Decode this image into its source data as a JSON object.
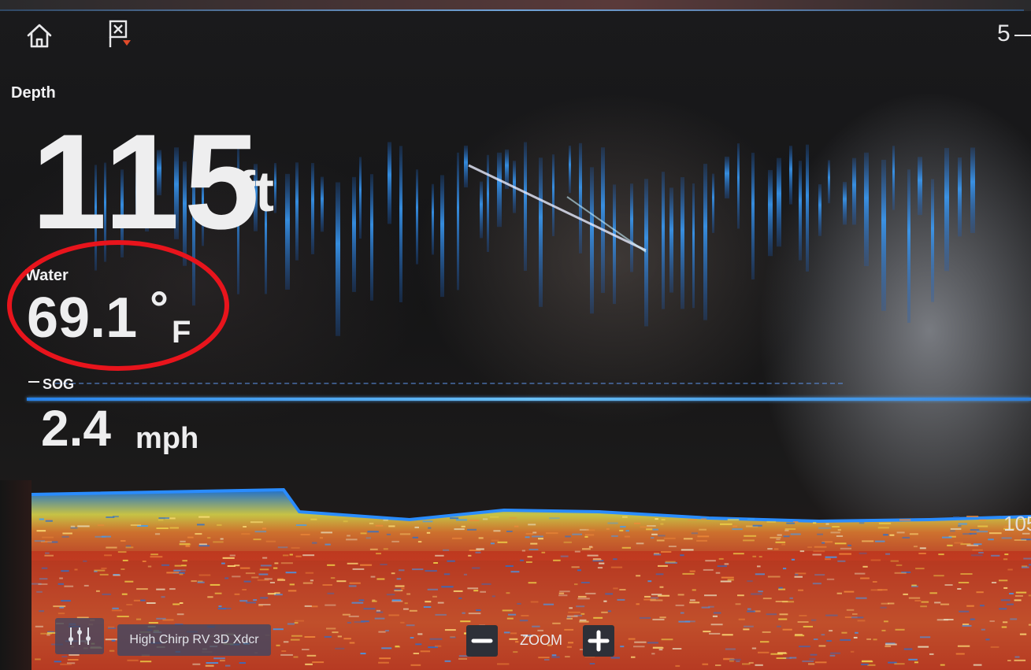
{
  "header": {
    "home_icon": "home-icon",
    "waypoint_icon": "waypoint-flag-icon",
    "range_top": "5"
  },
  "depth": {
    "label": "Depth",
    "value": "115",
    "unit": "ft"
  },
  "water": {
    "label": "Water",
    "value": "69.1",
    "degree": "°",
    "unit": "F"
  },
  "sog": {
    "label": "SOG",
    "value": "2.4",
    "unit": "mph"
  },
  "scale": {
    "range_right": "105"
  },
  "controls": {
    "settings_icon": "sliders-icon",
    "transducer_label": "High Chirp RV 3D Xdcr",
    "zoom_label": "ZOOM",
    "zoom_out_icon": "minus-icon",
    "zoom_in_icon": "plus-icon"
  },
  "colors": {
    "annotation_ellipse": "#e8141c",
    "surface_line": "#2b8cff",
    "seabed_red": "#c8462a",
    "button_bg": "#3c4664"
  }
}
